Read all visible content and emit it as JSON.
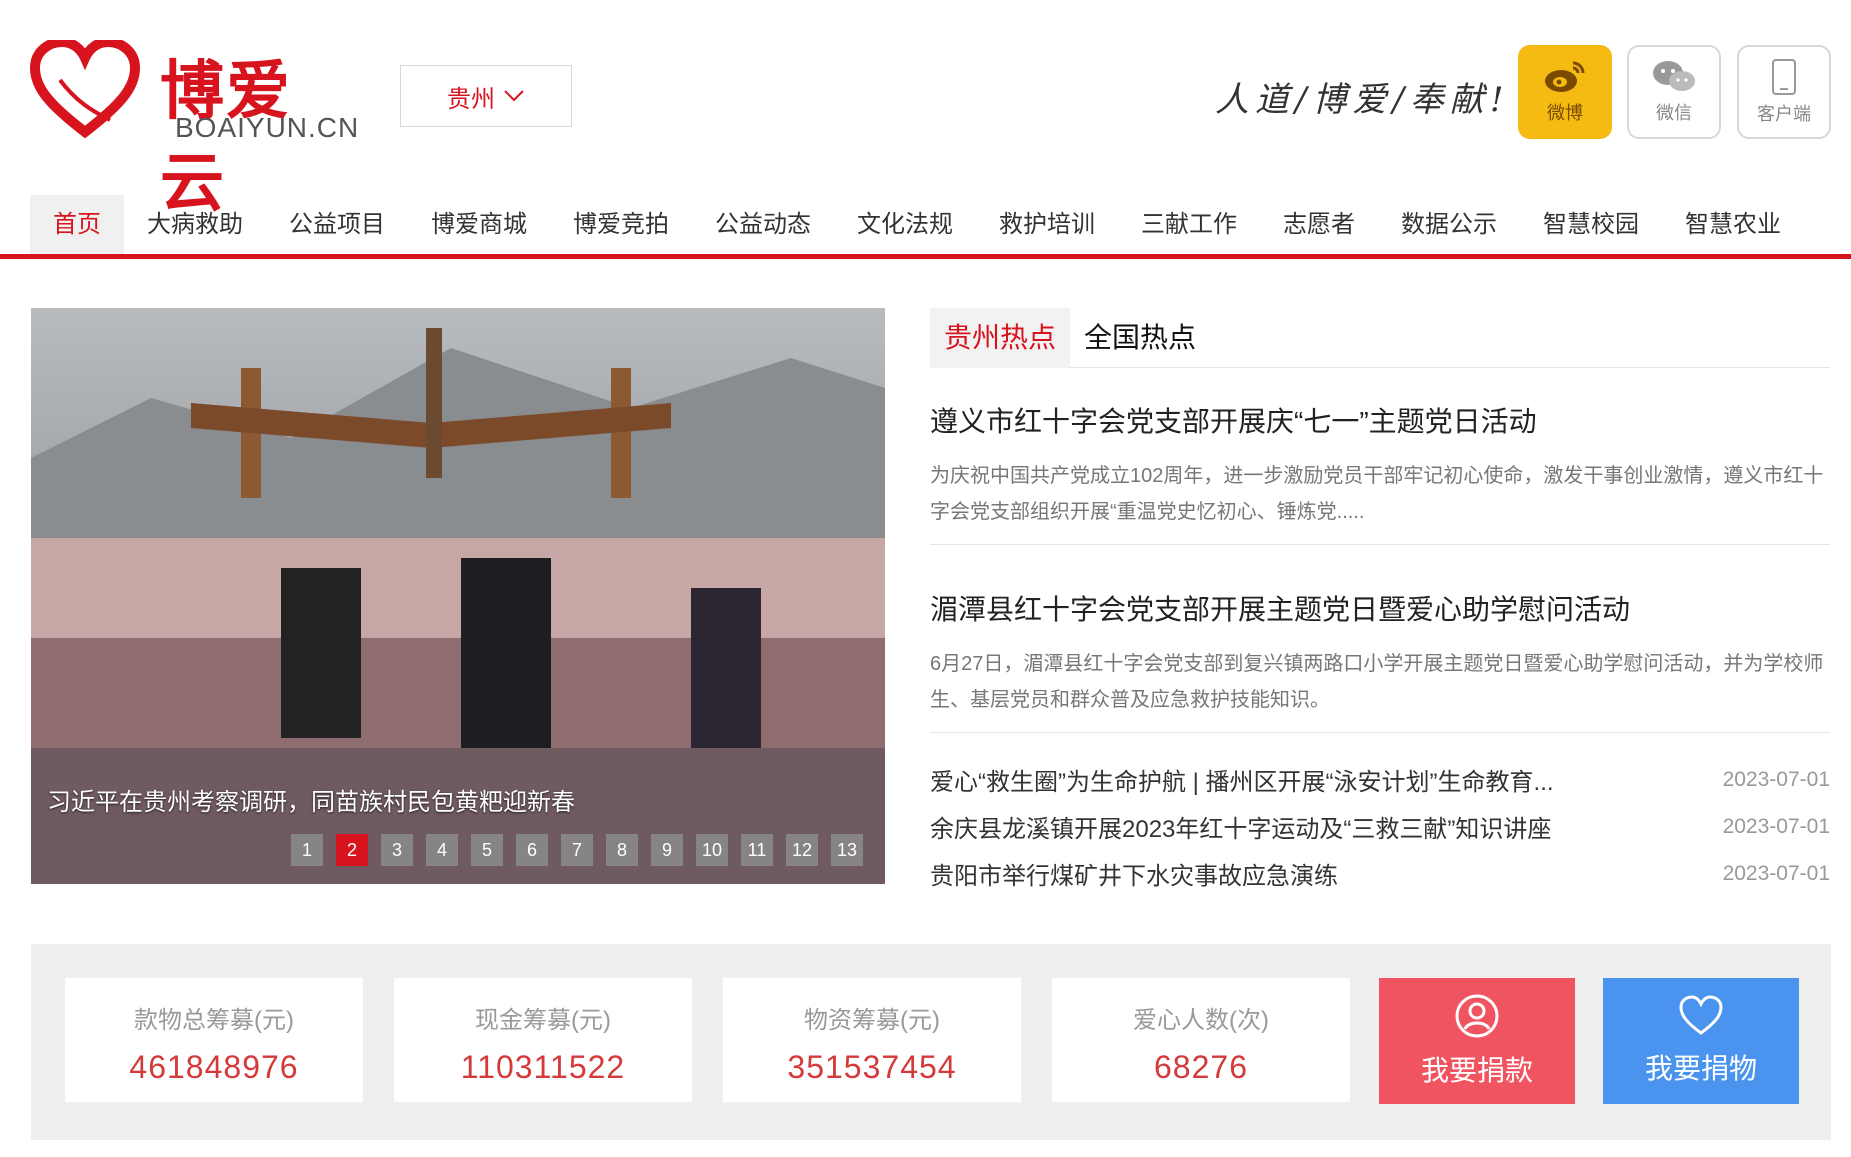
{
  "header": {
    "brand": "博爱云",
    "domain": "BOAIYUN.CN",
    "region": "贵州",
    "slogan": "人道/博爱/奉献!",
    "social": [
      {
        "label": "微博",
        "icon": "weibo-icon"
      },
      {
        "label": "微信",
        "icon": "wechat-icon"
      },
      {
        "label": "客户端",
        "icon": "mobile-icon"
      }
    ]
  },
  "nav": {
    "items": [
      "首页",
      "大病救助",
      "公益项目",
      "博爱商城",
      "博爱竞拍",
      "公益动态",
      "文化法规",
      "救护培训",
      "三献工作",
      "志愿者",
      "数据公示",
      "智慧校园",
      "智慧农业"
    ],
    "active": 0
  },
  "carousel": {
    "caption": "习近平在贵州考察调研，同苗族村民包黄粑迎新春",
    "pages": [
      "1",
      "2",
      "3",
      "4",
      "5",
      "6",
      "7",
      "8",
      "9",
      "10",
      "11",
      "12",
      "13"
    ],
    "active_page": 2
  },
  "hot": {
    "tabs": [
      "贵州热点",
      "全国热点"
    ],
    "articles": [
      {
        "title": "遵义市红十字会党支部开展庆“七一”主题党日活动",
        "summary": "为庆祝中国共产党成立102周年，进一步激励党员干部牢记初心使命，激发干事创业激情，遵义市红十字会党支部组织开展“重温党史忆初心、锤炼党....."
      },
      {
        "title": "湄潭县红十字会党支部开展主题党日暨爱心助学慰问活动",
        "summary": "6月27日，湄潭县红十字会党支部到复兴镇两路口小学开展主题党日暨爱心助学慰问活动，并为学校师生、基层党员和群众普及应急救护技能知识。"
      }
    ],
    "list": [
      {
        "title": "爱心“救生圈”为生命护航 | 播州区开展“泳安计划”生命教育...",
        "date": "2023-07-01"
      },
      {
        "title": "余庆县龙溪镇开展2023年红十字运动及“三救三献”知识讲座",
        "date": "2023-07-01"
      },
      {
        "title": "贵阳市举行煤矿井下水灾事故应急演练",
        "date": "2023-07-01"
      }
    ]
  },
  "stats": [
    {
      "label": "款物总筹募(元)",
      "value": "461848976"
    },
    {
      "label": "现金筹募(元)",
      "value": "110311522"
    },
    {
      "label": "物资筹募(元)",
      "value": "351537454"
    },
    {
      "label": "爱心人数(次)",
      "value": "68276"
    }
  ],
  "actions": {
    "donate_money": "我要捐款",
    "donate_goods": "我要捐物"
  },
  "colors": {
    "brand_red": "#d7141e",
    "weibo_yellow": "#f5bb13",
    "donate_red": "#f15461",
    "donate_blue": "#4a94ef"
  }
}
